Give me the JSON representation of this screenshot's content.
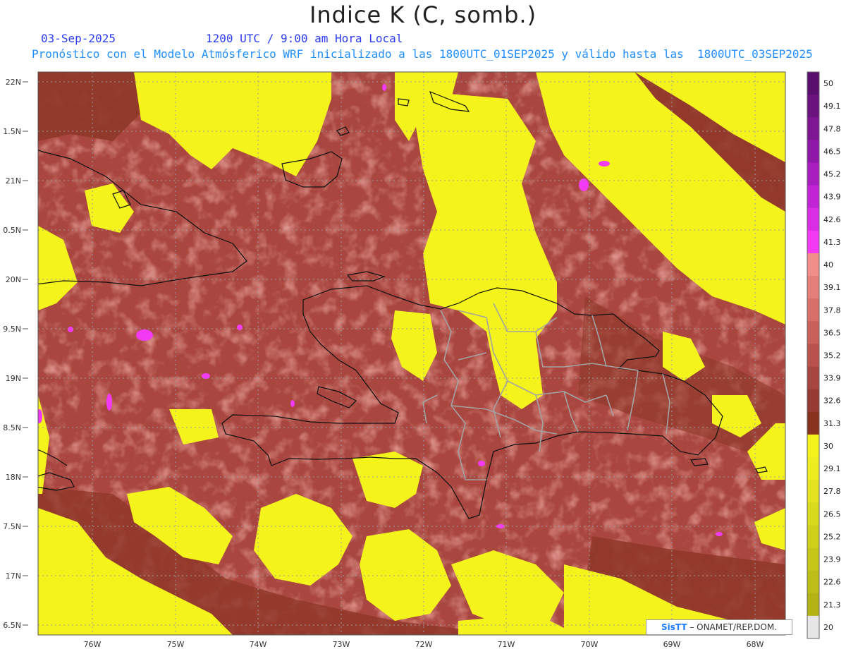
{
  "title": "Indice K (C, somb.)",
  "date": "03-Sep-2025",
  "time": "1200 UTC / 9:00 am Hora Local",
  "description": "Pronóstico con el Modelo Atmósferico WRF inicializado a las 1800UTC_01SEP2025 y válido hasta las  1800UTC_03SEP2025",
  "credit": {
    "brand": "SisTT",
    "text": " – ONAMET/REP.DOM."
  },
  "map_data": {
    "lat_labels": [
      "22N",
      "1.5N",
      "21N",
      "0.5N",
      "20N",
      "9.5N",
      "19N",
      "8.5N",
      "18N",
      "7.5N",
      "17N",
      "6.5N"
    ],
    "lon_labels": [
      "76W",
      "75W",
      "74W",
      "73W",
      "72W",
      "71W",
      "70W",
      "69W",
      "68W"
    ],
    "colorbar": [
      {
        "label": "50",
        "color": "#5a0f6e"
      },
      {
        "label": "49.1",
        "color": "#6b127f"
      },
      {
        "label": "47.8",
        "color": "#7e1593"
      },
      {
        "label": "46.5",
        "color": "#9018a8"
      },
      {
        "label": "45.2",
        "color": "#a91ebf"
      },
      {
        "label": "43.9",
        "color": "#c024d4"
      },
      {
        "label": "42.6",
        "color": "#d92de6"
      },
      {
        "label": "41.3",
        "color": "#f23af5"
      },
      {
        "label": "40",
        "color": "#f08e8a"
      },
      {
        "label": "39.1",
        "color": "#e47f79"
      },
      {
        "label": "37.8",
        "color": "#d86f69"
      },
      {
        "label": "36.5",
        "color": "#c9605a"
      },
      {
        "label": "35.2",
        "color": "#b9524c"
      },
      {
        "label": "33.9",
        "color": "#a74540"
      },
      {
        "label": "32.6",
        "color": "#973b34"
      },
      {
        "label": "31.3",
        "color": "#88321f"
      },
      {
        "label": "30",
        "color": "#f4f41c"
      },
      {
        "label": "29.1",
        "color": "#eded22"
      },
      {
        "label": "27.8",
        "color": "#e3e31f"
      },
      {
        "label": "26.5",
        "color": "#dada1d"
      },
      {
        "label": "25.2",
        "color": "#d0d01b"
      },
      {
        "label": "23.9",
        "color": "#c6c619"
      },
      {
        "label": "22.6",
        "color": "#bdbd17"
      },
      {
        "label": "21.3",
        "color": "#b3b315"
      },
      {
        "label": "20",
        "color": "#e6e6e6"
      }
    ]
  }
}
